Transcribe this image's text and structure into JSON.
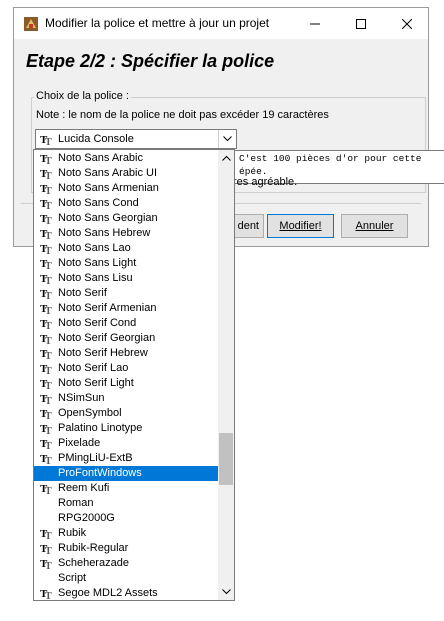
{
  "window": {
    "title": "Modifier la police et mettre à jour un projet",
    "heading": "Etape 2/2 : Spécifier la police",
    "group_label": "Choix de la police :",
    "note": "Note : le nom de la police ne doit pas excéder 19 caractères",
    "hint_text": "res agréable.",
    "buttons": {
      "previous": "dent",
      "modify": "Modifier!",
      "cancel": "Annuler"
    }
  },
  "combo": {
    "selected_value": "Lucida Console",
    "icon": "truetype-font-icon"
  },
  "preview": {
    "text": "C'est 100 pièces d'or pour cette épée."
  },
  "dropdown": {
    "items": [
      {
        "label": "Noto Sans Arabic",
        "truetype": true
      },
      {
        "label": "Noto Sans Arabic UI",
        "truetype": true
      },
      {
        "label": "Noto Sans Armenian",
        "truetype": true
      },
      {
        "label": "Noto Sans Cond",
        "truetype": true
      },
      {
        "label": "Noto Sans Georgian",
        "truetype": true
      },
      {
        "label": "Noto Sans Hebrew",
        "truetype": true
      },
      {
        "label": "Noto Sans Lao",
        "truetype": true
      },
      {
        "label": "Noto Sans Light",
        "truetype": true
      },
      {
        "label": "Noto Sans Lisu",
        "truetype": true
      },
      {
        "label": "Noto Serif",
        "truetype": true
      },
      {
        "label": "Noto Serif Armenian",
        "truetype": true
      },
      {
        "label": "Noto Serif Cond",
        "truetype": true
      },
      {
        "label": "Noto Serif Georgian",
        "truetype": true
      },
      {
        "label": "Noto Serif Hebrew",
        "truetype": true
      },
      {
        "label": "Noto Serif Lao",
        "truetype": true
      },
      {
        "label": "Noto Serif Light",
        "truetype": true
      },
      {
        "label": "NSimSun",
        "truetype": true
      },
      {
        "label": "OpenSymbol",
        "truetype": true
      },
      {
        "label": "Palatino Linotype",
        "truetype": true
      },
      {
        "label": "Pixelade",
        "truetype": true
      },
      {
        "label": "PMingLiU-ExtB",
        "truetype": true
      },
      {
        "label": "ProFontWindows",
        "truetype": false,
        "selected": true
      },
      {
        "label": "Reem Kufi",
        "truetype": true
      },
      {
        "label": "Roman",
        "truetype": false
      },
      {
        "label": "RPG2000G",
        "truetype": false
      },
      {
        "label": "Rubik",
        "truetype": true
      },
      {
        "label": "Rubik-Regular",
        "truetype": true
      },
      {
        "label": "Scheherazade",
        "truetype": true
      },
      {
        "label": "Script",
        "truetype": false
      },
      {
        "label": "Segoe MDL2 Assets",
        "truetype": true
      }
    ]
  },
  "colors": {
    "selection": "#0078d7",
    "focus_border": "#0078d7"
  }
}
